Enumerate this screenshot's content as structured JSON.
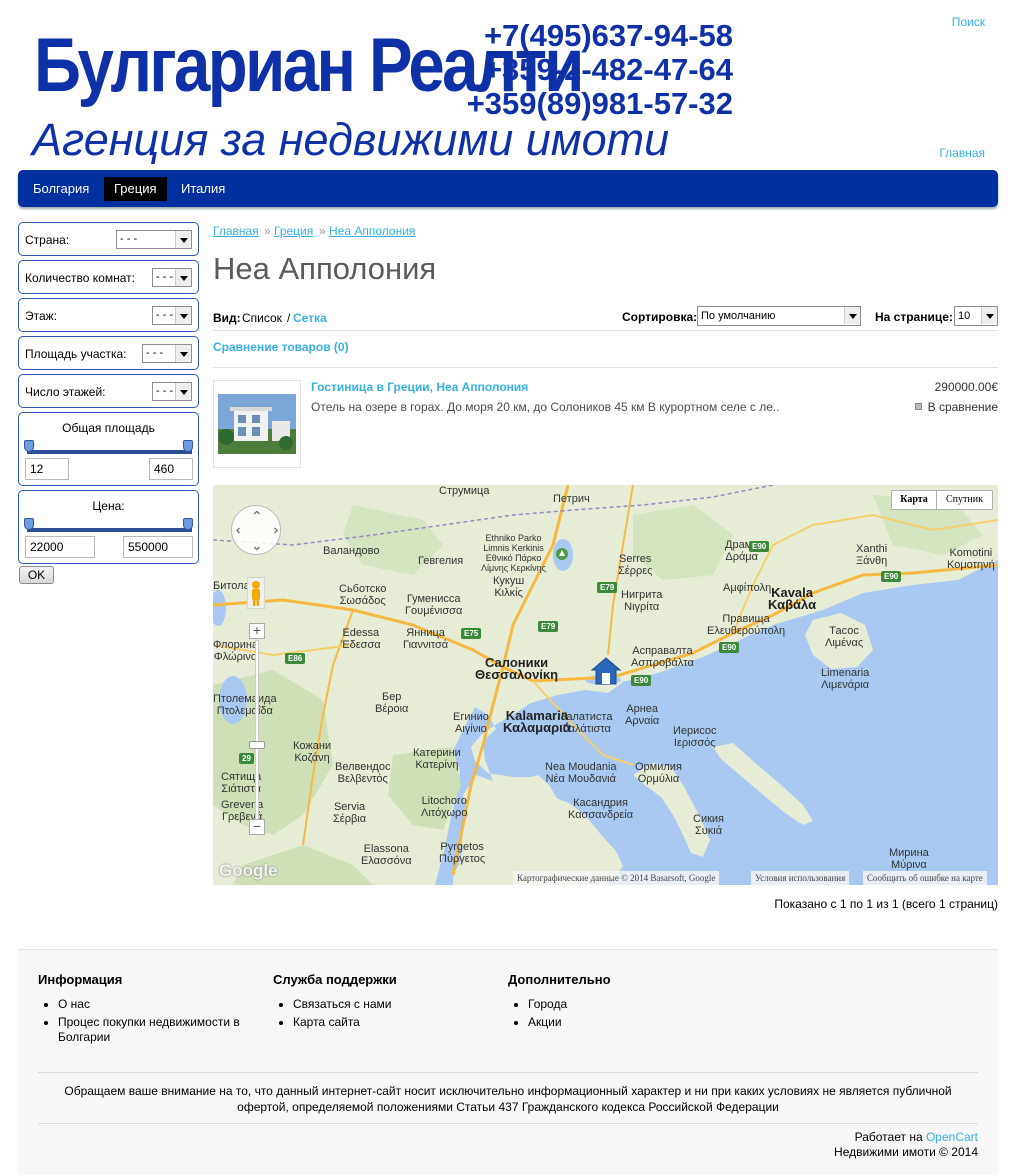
{
  "header": {
    "brand": "Булгариан Реалти",
    "phones": [
      "+7(495)637-94-58",
      "+359-2-482-47-64",
      "+359(89)981-57-32"
    ],
    "tagline": "Агенция за недвижими имоти",
    "search_link": "Поиск",
    "home_link": "Главная"
  },
  "menu": {
    "items": [
      {
        "label": "Болгария"
      },
      {
        "label": "Греция"
      },
      {
        "label": "Италия"
      }
    ],
    "active": "Греция"
  },
  "filters": {
    "country": {
      "label": "Страна:",
      "value": "- - -"
    },
    "rooms": {
      "label": "Количество комнат:",
      "value": "- - -"
    },
    "floor": {
      "label": "Этаж:",
      "value": "- - -"
    },
    "plot_area": {
      "label": "Площадь участка:",
      "value": "- - -"
    },
    "floors_count": {
      "label": "Число этажей:",
      "value": "- - -"
    },
    "total_area": {
      "title": "Общая площадь",
      "min": "12",
      "max": "460",
      "range_fraction": [
        0.0,
        1.0
      ]
    },
    "price": {
      "title": "Цена:",
      "min": "22000",
      "max": "550000",
      "range_fraction": [
        0.0,
        1.0
      ]
    },
    "ok_label": "OK"
  },
  "breadcrumb": {
    "items": [
      "Главная",
      "Греция",
      "Неа Апполония"
    ],
    "separator": "»"
  },
  "page_title": "Неа Апполония",
  "view_bar": {
    "view_label": "Вид:",
    "list": "Список",
    "slash": "/",
    "grid": "Сетка",
    "sort_label": "Сортировка:",
    "sort_value": "По умолчанию",
    "per_page_label": "На странице:",
    "per_page_value": "10"
  },
  "compare_link": "Сравнение товаров (0)",
  "products": [
    {
      "name": "Гостиница в Греции, Неа Апполония",
      "description": "Отель на озере в горах. До моря 20 км, до Солоников 45 км В курортном селе с ле..",
      "price": "290000.00€",
      "compare_label": "В сравнение"
    }
  ],
  "map": {
    "type_buttons": [
      "Карта",
      "Спутник"
    ],
    "attribution": [
      "Картографические данные © 2014 Basarsoft, Google",
      "Условия использования",
      "Сообщить об ошибке на карте"
    ],
    "logo": "Google",
    "labels": [
      {
        "text": "Струмица"
      },
      {
        "text": "Петрич"
      },
      {
        "text": "Ethniko Parko\nLimnis Kerkinis\nΕθνικό Πάρκο\nΛίμνης Κερκίνης"
      },
      {
        "text": "Serres\nΣέρρες"
      },
      {
        "text": "Драма\nΔράμα"
      },
      {
        "text": "Xanthi\nΞάνθη"
      },
      {
        "text": "Komotini\nΚομοτηνή"
      },
      {
        "text": "Валандово"
      },
      {
        "text": "Гевгелия"
      },
      {
        "text": "Кукуш\nΚιλκίς"
      },
      {
        "text": "Αμφίπολη"
      },
      {
        "text": "Kavala\nΚαβάλα"
      },
      {
        "text": "Битола"
      },
      {
        "text": "Сьботско\nΣωσάδος"
      },
      {
        "text": "Гуменисса\nΓουμένισσα"
      },
      {
        "text": "Нигрита\nΝιγρίτα"
      },
      {
        "text": "Правища\nΕλευθερούπολη"
      },
      {
        "text": "Тасос\nΛιμένας"
      },
      {
        "text": "Флорина\nΦλώρινα"
      },
      {
        "text": "Edessa\nΈδεσσα"
      },
      {
        "text": "Янница\nΓιαννιτσά"
      },
      {
        "text": "Салоники\nΘεσσαλονίκη"
      },
      {
        "text": "Асправалта\nΑσπροβάλτα"
      },
      {
        "text": "Limenaria\nΛιμενάρια"
      },
      {
        "text": "Птолемаида\nΠτολεμαΐδα"
      },
      {
        "text": "Бер\nΒέροια"
      },
      {
        "text": "Егинио\nΑιγίνιο"
      },
      {
        "text": "Kalamaria\nΚαλαμαριά"
      },
      {
        "text": "Галатиста\nΓαλάτιστα"
      },
      {
        "text": "Арнеа\nΑρναία"
      },
      {
        "text": "Иерисос\nΙερισσός"
      },
      {
        "text": "Кожани\nΚοζάνη"
      },
      {
        "text": "Катерини\nΚατερίνη"
      },
      {
        "text": "Nea Moudania\nΝέα Μουδανιά"
      },
      {
        "text": "Ормилия\nΟρμύλια"
      },
      {
        "text": "Сятища\nΣιάτιστα"
      },
      {
        "text": "Велвендос\nΒελβεντός"
      },
      {
        "text": "Grevena\nΓρεβενά"
      },
      {
        "text": "Servia\nΣέρβια"
      },
      {
        "text": "Litochoro\nΛιτόχωρο"
      },
      {
        "text": "Касандрия\nΚασσανδρεία"
      },
      {
        "text": "Сикия\nΣυκιά"
      },
      {
        "text": "Pyrgetos\nΠύργετος"
      },
      {
        "text": "Elassona\nΕλασσόνα"
      },
      {
        "text": "Мирина\nΜύρινα"
      }
    ],
    "roads": [
      "E79",
      "E75",
      "E86",
      "E90",
      "E90",
      "E90",
      "E79",
      "29",
      "E90"
    ]
  },
  "pagination": "Показано с 1 по 1 из 1 (всего 1 страниц)",
  "footer": {
    "columns": [
      {
        "title": "Информация",
        "links": [
          "О нас",
          "Процес покупки недвижимости в Болгарии"
        ]
      },
      {
        "title": "Служба поддержки",
        "links": [
          "Связаться с нами",
          "Карта сайта"
        ]
      },
      {
        "title": "Дополнительно",
        "links": [
          "Города",
          "Акции"
        ]
      }
    ],
    "disclaimer": "Обращаем ваше внимание на то, что данный интернет-сайт носит исключительно информационный характер и ни при каких условиях не является публичной офертой, определяемой положениями Статьи 437 Гражданского кодекса Российской Федерации",
    "powered_prefix": "Работает на",
    "powered_link": "OpenCart",
    "copyright": "Недвижими имоти © 2014"
  },
  "colors": {
    "brand_blue": "#0f31a8",
    "menu_bg": "#00309f",
    "link": "#38b0e3",
    "sea": "#a9c9f3",
    "land": "#e8eedc"
  }
}
